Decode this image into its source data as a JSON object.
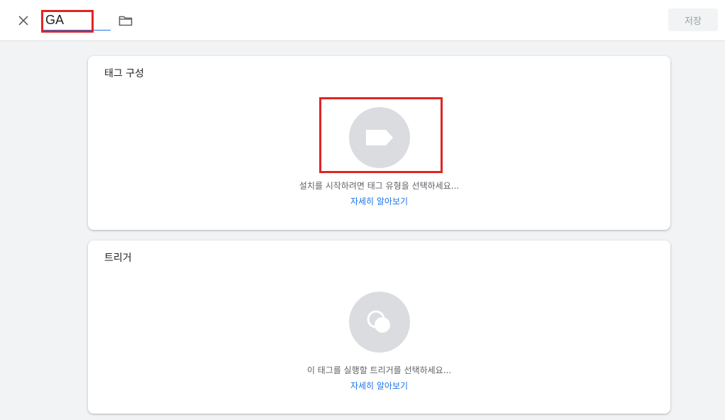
{
  "header": {
    "close_icon": "close-icon",
    "tag_name": "GA",
    "folder_icon": "folder-icon",
    "save_label": "저장"
  },
  "tag_config": {
    "title": "태그 구성",
    "icon": "tag-icon",
    "hint": "설치를 시작하려면 태그 유형을 선택하세요...",
    "learn_more": "자세히 알아보기"
  },
  "trigger": {
    "title": "트리거",
    "icon": "trigger-icon",
    "hint": "이 태그를 실행할 트리거를 선택하세요...",
    "learn_more": "자세히 알아보기"
  },
  "colors": {
    "accent": "#1a73e8",
    "highlight": "#e02424",
    "background": "#f1f3f4",
    "icon_circle": "#dadce0"
  }
}
